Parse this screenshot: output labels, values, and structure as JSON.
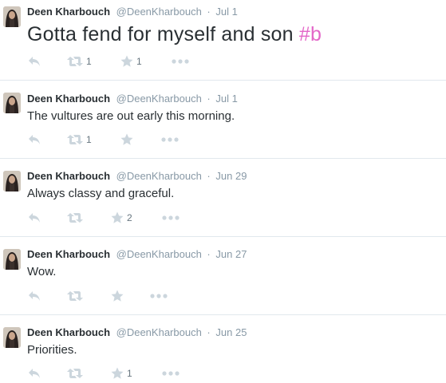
{
  "colors": {
    "name": "#292f33",
    "meta": "#8899a6",
    "icon": "#ccd6dd",
    "hashtag": "#e366c8",
    "divider": "#e1e8ed"
  },
  "tweets": [
    {
      "fullname": "Deen Kharbouch",
      "username": "@DeenKharbouch",
      "dot": "·",
      "time": "Jul 1",
      "text": "Gotta fend for myself and son ",
      "hashtag": "#b",
      "retweets": "1",
      "favorites": "1"
    },
    {
      "fullname": "Deen Kharbouch",
      "username": "@DeenKharbouch",
      "dot": "·",
      "time": "Jul 1",
      "text": "The vultures are out early this morning.",
      "retweets": "1",
      "favorites": ""
    },
    {
      "fullname": "Deen Kharbouch",
      "username": "@DeenKharbouch",
      "dot": "·",
      "time": "Jun 29",
      "text": "Always classy and graceful.",
      "retweets": "",
      "favorites": "2"
    },
    {
      "fullname": "Deen Kharbouch",
      "username": "@DeenKharbouch",
      "dot": "·",
      "time": "Jun 27",
      "text": "Wow.",
      "retweets": "",
      "favorites": ""
    },
    {
      "fullname": "Deen Kharbouch",
      "username": "@DeenKharbouch",
      "dot": "·",
      "time": "Jun 25",
      "text": "Priorities.",
      "retweets": "",
      "favorites": "1"
    }
  ],
  "icons": {
    "reply": "reply-icon",
    "retweet": "retweet-icon",
    "favorite": "star-icon",
    "more": "more-icon"
  }
}
